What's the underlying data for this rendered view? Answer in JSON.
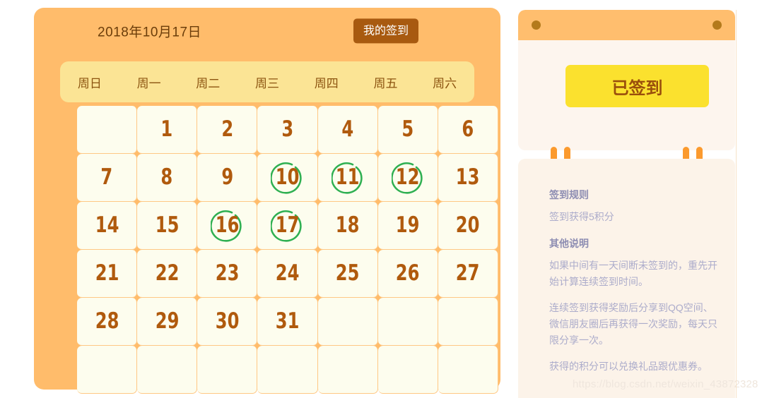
{
  "calendar": {
    "date_label": "2018年10月17日",
    "my_checkin_label": "我的签到",
    "weekdays": [
      "周日",
      "周一",
      "周二",
      "周三",
      "周四",
      "周五",
      "周六"
    ],
    "leading_blanks": 1,
    "days_in_month": 31,
    "total_cells": 42,
    "checked_days": [
      10,
      11,
      12,
      16,
      17
    ],
    "colors": {
      "card_background": "#FFBC6B",
      "weekday_header": "#FBE495",
      "day_cell": "#FDFDEE",
      "day_number": "#B05A0D",
      "checkin_ring": "#2FB052",
      "button_background": "#A85A10"
    }
  },
  "checkin_panel": {
    "checked_in_label": "已签到",
    "colors": {
      "topbar": "#FFBE6E",
      "topbar_dot": "#B47A1C",
      "button_background": "#FBE12E",
      "button_text": "#9A4F0C",
      "clip": "#FB9A2E",
      "card_background": "#FDF5EE"
    }
  },
  "rules_panel": {
    "sections": [
      {
        "heading": "签到规则",
        "paragraphs": [
          "签到获得5积分"
        ]
      },
      {
        "heading": "其他说明",
        "paragraphs": [
          "如果中间有一天间断未签到的，重先开始计算连续签到时间。",
          "连续签到获得奖励后分享到QQ空间、微信朋友圈后再获得一次奖励，每天只限分享一次。",
          "获得的积分可以兑换礼品跟优惠券。"
        ]
      }
    ],
    "colors": {
      "heading": "#8D8DB2",
      "body": "#ACACCB",
      "background": "#FCF3E9"
    }
  },
  "watermark": {
    "text": "https://blog.csdn.net/weixin_43872328"
  }
}
